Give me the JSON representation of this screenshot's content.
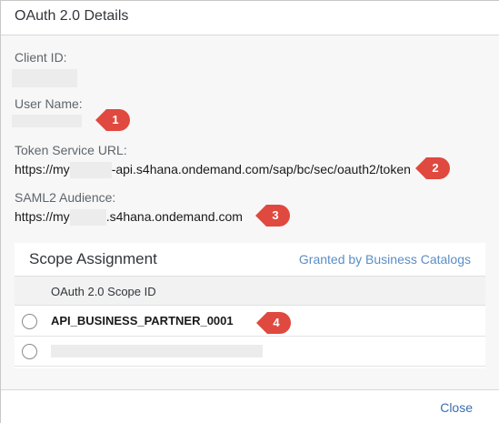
{
  "dialog": {
    "title": "OAuth 2.0 Details",
    "close_label": "Close"
  },
  "fields": {
    "client_id_label": "Client ID:",
    "user_name_label": "User Name:",
    "token_url_label": "Token Service URL:",
    "token_url_prefix": "https://my",
    "token_url_suffix": "-api.s4hana.ondemand.com/sap/bc/sec/oauth2/token",
    "saml_label": "SAML2 Audience:",
    "saml_prefix": "https://my",
    "saml_suffix": ".s4hana.ondemand.com"
  },
  "annotations": {
    "one": "1",
    "two": "2",
    "three": "3",
    "four": "4"
  },
  "annotation_color": "#e0493f",
  "scope": {
    "title": "Scope Assignment",
    "link_label": "Granted by Business Catalogs",
    "column_header": "OAuth 2.0 Scope ID",
    "rows": [
      {
        "scope_id": "API_BUSINESS_PARTNER_0001"
      }
    ]
  }
}
